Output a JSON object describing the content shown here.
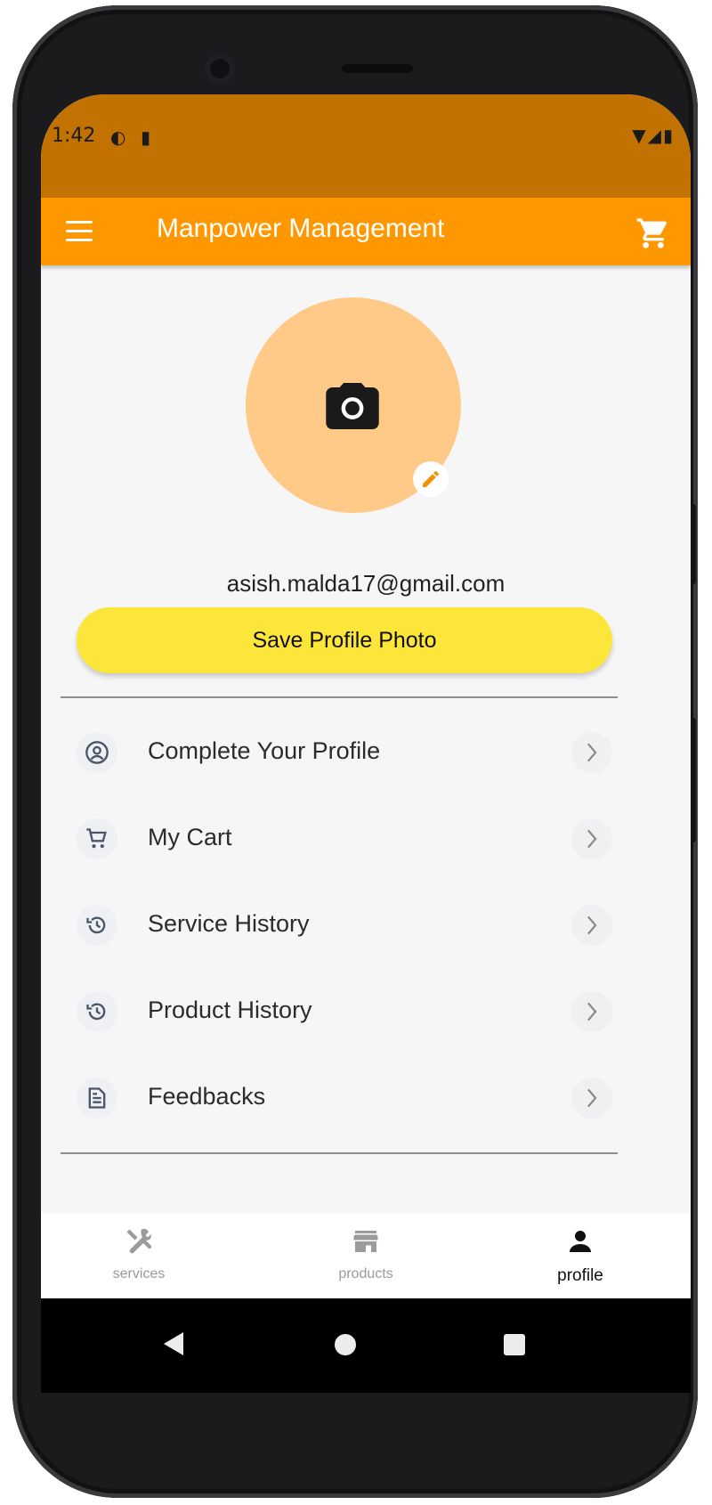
{
  "statusbar": {
    "time": "1:42"
  },
  "appbar": {
    "title": "Manpower Management",
    "menu_icon": "menu-icon",
    "cart_icon": "cart-icon"
  },
  "profile": {
    "avatar_icon": "camera-icon",
    "edit_icon": "pencil-icon",
    "email": "asish.malda17@gmail.com",
    "save_button": "Save Profile Photo"
  },
  "menu": {
    "items": [
      {
        "label": "Complete Your Profile",
        "icon": "account-circle-icon"
      },
      {
        "label": "My Cart",
        "icon": "cart-icon"
      },
      {
        "label": "Service History",
        "icon": "history-icon"
      },
      {
        "label": "Product History",
        "icon": "history-icon"
      },
      {
        "label": "Feedbacks",
        "icon": "document-icon"
      }
    ]
  },
  "bottom_nav": {
    "items": [
      {
        "label": "services",
        "icon": "tools-icon",
        "active": false
      },
      {
        "label": "products",
        "icon": "store-icon",
        "active": false
      },
      {
        "label": "profile",
        "icon": "person-icon",
        "active": true
      }
    ]
  },
  "colors": {
    "statusbar": "#c17200",
    "appbar": "#ff9800",
    "avatar": "#ffc987",
    "save_button": "#fde63a"
  }
}
